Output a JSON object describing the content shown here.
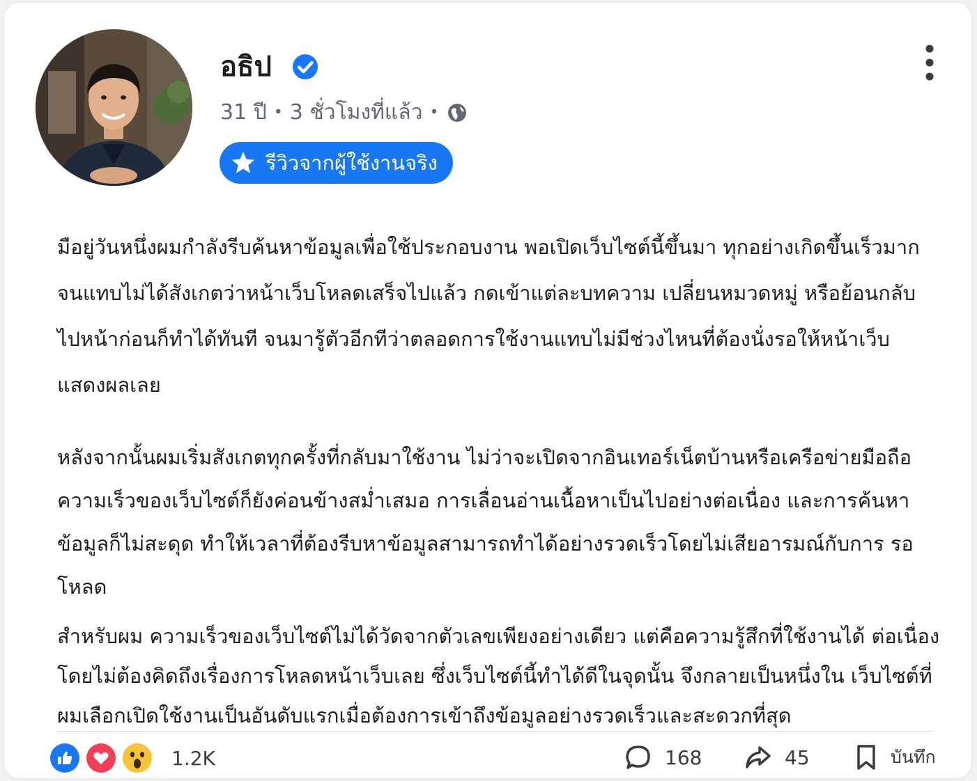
{
  "post": {
    "author": {
      "name": "อธิป",
      "verified": true
    },
    "meta": {
      "age": "31 ปี",
      "time": "3 ชั่วโมงที่แล้ว",
      "privacy_icon": "globe-icon"
    },
    "badge": {
      "label": "รีวิวจากผู้ใช้งานจริง",
      "icon": "star-icon",
      "color": "#1877f2"
    },
    "paragraphs": [
      "มือยู่วันหนึ่งผมกำลังรีบค้นหาข้อมูลเพื่อใช้ประกอบงาน พอเปิดเว็บไซต์นี้ขึ้นมา ทุกอย่างเกิดขึ้นเร็วมาก จนแทบไม่ได้สังเกตว่าหน้าเว็บโหลดเสร็จไปแล้ว กดเข้าแต่ละบทความ เปลี่ยนหมวดหมู่ หรือย้อนกลับ ไปหน้าก่อนก็ทำได้ทันที จนมารู้ตัวอีกทีว่าตลอดการใช้งานแทบไม่มีช่วงไหนที่ต้องนั่งรอให้หน้าเว็บ แสดงผลเลย",
      "หลังจากนั้นผมเริ่มสังเกตทุกครั้งที่กลับมาใช้งาน ไม่ว่าจะเปิดจากอินเทอร์เน็ตบ้านหรือเครือข่ายมือถือ ความเร็วของเว็บไซต์ก็ยังค่อนข้างสม่ำเสมอ การเลื่อนอ่านเนื้อหาเป็นไปอย่างต่อเนื่อง และการค้นหา ข้อมูลก็ไม่สะดุด ทำให้เวลาที่ต้องรีบหาข้อมูลสามารถทำได้อย่างรวดเร็วโดยไม่เสียอารมณ์กับการ รอโหลด",
      "สำหรับผม ความเร็วของเว็บไซต์ไม่ได้วัดจากตัวเลขเพียงอย่างเดียว แต่คือความรู้สึกที่ใช้งานได้ ต่อเนื่องโดยไม่ต้องคิดถึงเรื่องการโหลดหน้าเว็บเลย ซึ่งเว็บไซต์นี้ทำได้ดีในจุดนั้น จึงกลายเป็นหนึ่งใน เว็บไซต์ที่ผมเลือกเปิดใช้งานเป็นอันดับแรกเมื่อต้องการเข้าถึงข้อมูลอย่างรวดเร็วและสะดวกที่สุด"
    ],
    "footer": {
      "reactions": [
        "like-icon",
        "love-icon",
        "wow-icon"
      ],
      "reaction_count": "1.2K",
      "comment_count": "168",
      "share_count": "45",
      "save_label": "บันทึก"
    }
  }
}
